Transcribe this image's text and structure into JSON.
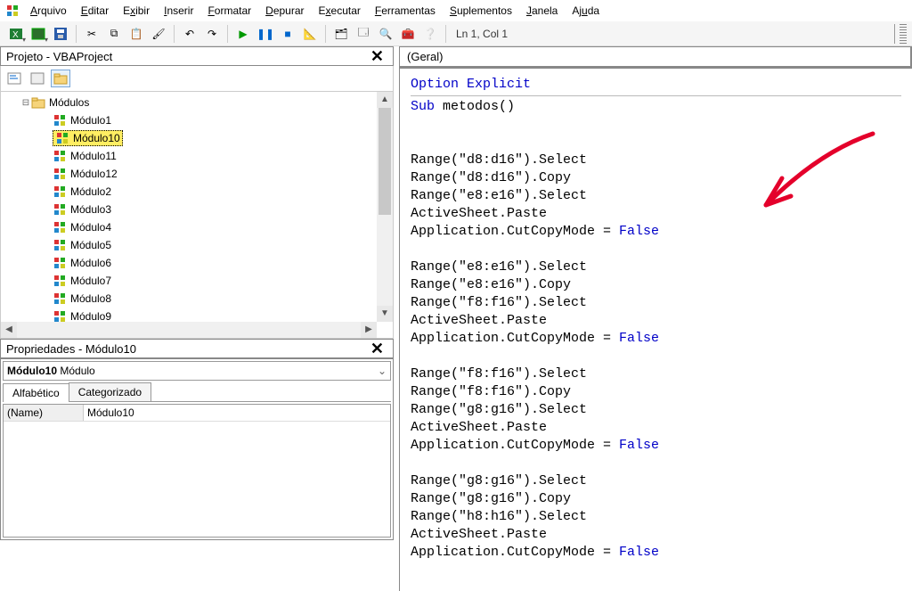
{
  "menu": {
    "items": [
      "Arquivo",
      "Editar",
      "Exibir",
      "Inserir",
      "Formatar",
      "Depurar",
      "Executar",
      "Ferramentas",
      "Suplementos",
      "Janela",
      "Ajuda"
    ],
    "accel": [
      0,
      0,
      1,
      0,
      0,
      0,
      1,
      0,
      0,
      0,
      2
    ]
  },
  "toolbar": {
    "cursor": "Ln 1, Col 1"
  },
  "project": {
    "title": "Projeto - VBAProject",
    "folder": "Módulos",
    "modules": [
      "Módulo1",
      "Módulo10",
      "Módulo11",
      "Módulo12",
      "Módulo2",
      "Módulo3",
      "Módulo4",
      "Módulo5",
      "Módulo6",
      "Módulo7",
      "Módulo8",
      "Módulo9"
    ],
    "selected": "Módulo10"
  },
  "properties": {
    "title": "Propriedades - Módulo10",
    "object_name": "Módulo10",
    "object_type": "Módulo",
    "tabs": [
      "Alfabético",
      "Categorizado"
    ],
    "row_key": "(Name)",
    "row_val": "Módulo10"
  },
  "editor": {
    "combo_left": "(Geral)",
    "code_tokens": [
      {
        "t": "kw",
        "s": "Option Explicit"
      },
      {
        "t": "hr"
      },
      {
        "t": "mix",
        "pre": "Sub ",
        "plain": "metodos()",
        "kw": "Sub"
      },
      {
        "t": "nl"
      },
      {
        "t": "nl"
      },
      {
        "t": "plain",
        "s": "Range(\"d8:d16\").Select"
      },
      {
        "t": "plain",
        "s": "Range(\"d8:d16\").Copy"
      },
      {
        "t": "plain",
        "s": "Range(\"e8:e16\").Select"
      },
      {
        "t": "plain",
        "s": "ActiveSheet.Paste"
      },
      {
        "t": "assign",
        "lhs": "Application.CutCopyMode = ",
        "rhs": "False"
      },
      {
        "t": "nl"
      },
      {
        "t": "plain",
        "s": "Range(\"e8:e16\").Select"
      },
      {
        "t": "plain",
        "s": "Range(\"e8:e16\").Copy"
      },
      {
        "t": "plain",
        "s": "Range(\"f8:f16\").Select"
      },
      {
        "t": "plain",
        "s": "ActiveSheet.Paste"
      },
      {
        "t": "assign",
        "lhs": "Application.CutCopyMode = ",
        "rhs": "False"
      },
      {
        "t": "nl"
      },
      {
        "t": "plain",
        "s": "Range(\"f8:f16\").Select"
      },
      {
        "t": "plain",
        "s": "Range(\"f8:f16\").Copy"
      },
      {
        "t": "plain",
        "s": "Range(\"g8:g16\").Select"
      },
      {
        "t": "plain",
        "s": "ActiveSheet.Paste"
      },
      {
        "t": "assign",
        "lhs": "Application.CutCopyMode = ",
        "rhs": "False"
      },
      {
        "t": "nl"
      },
      {
        "t": "plain",
        "s": "Range(\"g8:g16\").Select"
      },
      {
        "t": "plain",
        "s": "Range(\"g8:g16\").Copy"
      },
      {
        "t": "plain",
        "s": "Range(\"h8:h16\").Select"
      },
      {
        "t": "plain",
        "s": "ActiveSheet.Paste"
      },
      {
        "t": "assign",
        "lhs": "Application.CutCopyMode = ",
        "rhs": "False"
      }
    ]
  }
}
